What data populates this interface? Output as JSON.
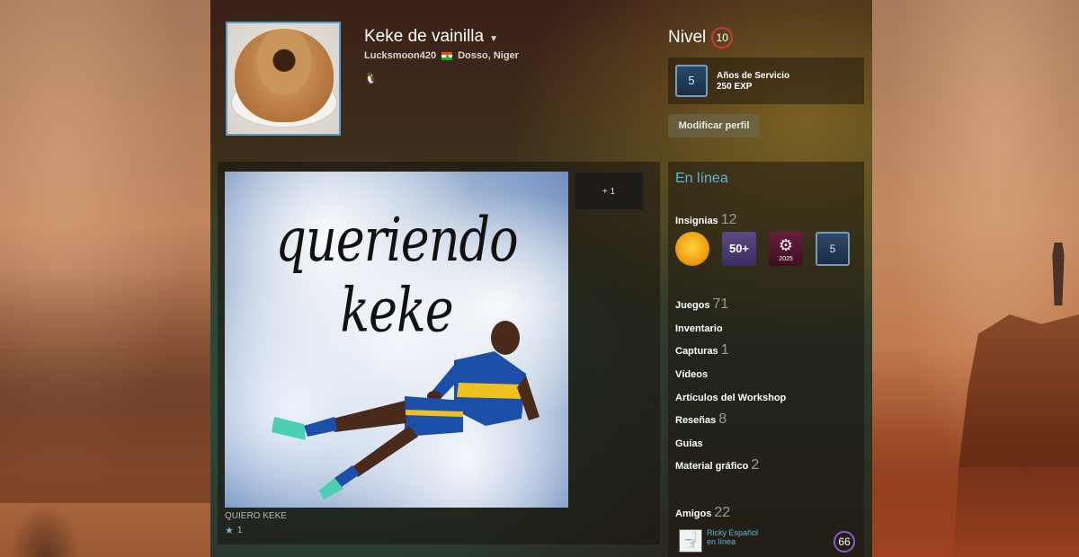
{
  "profile": {
    "persona_name": "Keke de vainilla",
    "account_name": "Lucksmoon420",
    "location": "Dosso, Niger",
    "level_label": "Nivel",
    "level": "10",
    "service_badge": {
      "years": "5",
      "title": "Años de Servicio",
      "exp": "250 EXP"
    },
    "edit_button": "Modificar perfil"
  },
  "showcase": {
    "meme_text": "queriendo keke",
    "caption": "QUIERO KEKE",
    "award_count": "1",
    "more_button": "+ 1"
  },
  "sidebar": {
    "status": "En línea",
    "badges": {
      "label": "Insignias",
      "count": "12",
      "items": [
        "coin-badge",
        "50+",
        "2025",
        "5"
      ]
    },
    "games": {
      "label": "Juegos",
      "count": "71"
    },
    "inventory": {
      "label": "Inventario"
    },
    "screenshots": {
      "label": "Capturas",
      "count": "1"
    },
    "videos": {
      "label": "Vídeos"
    },
    "workshop": {
      "label": "Artículos del Workshop"
    },
    "reviews": {
      "label": "Reseñas",
      "count": "8"
    },
    "guides": {
      "label": "Guías"
    },
    "artwork": {
      "label": "Material gráfico",
      "count": "2"
    },
    "friends": {
      "label": "Amigos",
      "count": "22",
      "list": [
        {
          "name": "Ricky Español",
          "status": "en línea",
          "level": "66"
        }
      ]
    }
  },
  "colors": {
    "accent_online": "#5fb6d6",
    "level_ring": "#d0383c",
    "friend_level_ring": "#8a5ad0"
  }
}
